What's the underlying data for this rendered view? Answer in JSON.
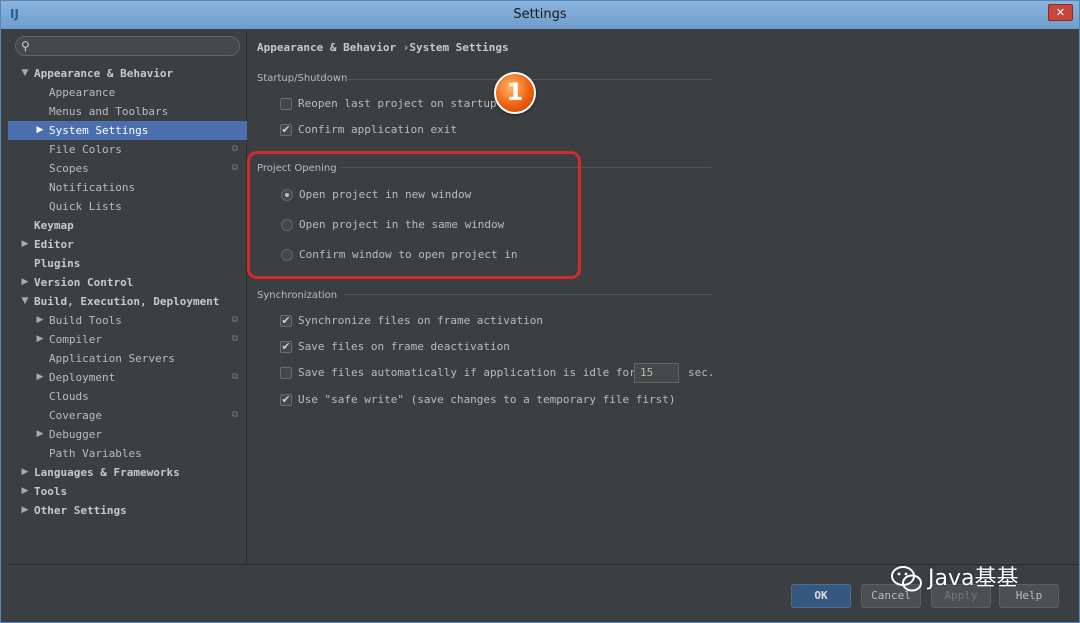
{
  "window": {
    "title": "Settings",
    "app_icon": "IJ",
    "close_label": "✕"
  },
  "search": {
    "placeholder": ""
  },
  "tree": [
    {
      "label": "Appearance & Behavior",
      "indent": 0,
      "expander": "▼",
      "bold": true
    },
    {
      "label": "Appearance",
      "indent": 1,
      "expander": "",
      "bold": false
    },
    {
      "label": "Menus and Toolbars",
      "indent": 1,
      "expander": "",
      "bold": false
    },
    {
      "label": "System Settings",
      "indent": 1,
      "expander": "▶",
      "bold": false,
      "selected": true
    },
    {
      "label": "File Colors",
      "indent": 1,
      "expander": "",
      "bold": false,
      "copy": true
    },
    {
      "label": "Scopes",
      "indent": 1,
      "expander": "",
      "bold": false,
      "copy": true
    },
    {
      "label": "Notifications",
      "indent": 1,
      "expander": "",
      "bold": false
    },
    {
      "label": "Quick Lists",
      "indent": 1,
      "expander": "",
      "bold": false
    },
    {
      "label": "Keymap",
      "indent": 0,
      "expander": "",
      "bold": true
    },
    {
      "label": "Editor",
      "indent": 0,
      "expander": "▶",
      "bold": true
    },
    {
      "label": "Plugins",
      "indent": 0,
      "expander": "",
      "bold": true
    },
    {
      "label": "Version Control",
      "indent": 0,
      "expander": "▶",
      "bold": true
    },
    {
      "label": "Build, Execution, Deployment",
      "indent": 0,
      "expander": "▼",
      "bold": true
    },
    {
      "label": "Build Tools",
      "indent": 1,
      "expander": "▶",
      "bold": false,
      "copy": true
    },
    {
      "label": "Compiler",
      "indent": 1,
      "expander": "▶",
      "bold": false,
      "copy": true
    },
    {
      "label": "Application Servers",
      "indent": 1,
      "expander": "",
      "bold": false
    },
    {
      "label": "Deployment",
      "indent": 1,
      "expander": "▶",
      "bold": false,
      "copy": true
    },
    {
      "label": "Clouds",
      "indent": 1,
      "expander": "",
      "bold": false
    },
    {
      "label": "Coverage",
      "indent": 1,
      "expander": "",
      "bold": false,
      "copy": true
    },
    {
      "label": "Debugger",
      "indent": 1,
      "expander": "▶",
      "bold": false
    },
    {
      "label": "Path Variables",
      "indent": 1,
      "expander": "",
      "bold": false
    },
    {
      "label": "Languages & Frameworks",
      "indent": 0,
      "expander": "▶",
      "bold": true
    },
    {
      "label": "Tools",
      "indent": 0,
      "expander": "▶",
      "bold": true
    },
    {
      "label": "Other Settings",
      "indent": 0,
      "expander": "▶",
      "bold": true
    }
  ],
  "breadcrumb": {
    "parent": "Appearance & Behavior",
    "separator": "›",
    "current": "System Settings"
  },
  "startup": {
    "title": "Startup/Shutdown",
    "reopen_label": "Reopen last project on startup",
    "reopen_checked": false,
    "confirm_exit_label": "Confirm application exit",
    "confirm_exit_checked": true
  },
  "project_opening": {
    "title": "Project Opening",
    "options": [
      {
        "label": "Open project in new window",
        "selected": true
      },
      {
        "label": "Open project in the same window",
        "selected": false
      },
      {
        "label": "Confirm window to open project in",
        "selected": false
      }
    ]
  },
  "sync": {
    "title": "Synchronization",
    "sync_frame_label": "Synchronize files on frame activation",
    "sync_frame_checked": true,
    "save_deactivation_label": "Save files on frame deactivation",
    "save_deactivation_checked": true,
    "save_idle_label": "Save files automatically if application is idle for",
    "save_idle_checked": false,
    "idle_value": "15",
    "idle_unit": "sec.",
    "safe_write_label": "Use \"safe write\" (save changes to a temporary file first)",
    "safe_write_checked": true
  },
  "annotation": {
    "badge": "1"
  },
  "footer": {
    "ok": "OK",
    "cancel": "Cancel",
    "apply": "Apply",
    "help": "Help"
  },
  "watermark": {
    "text": "Java基基"
  },
  "colors": {
    "selection": "#4b6eaf",
    "highlight_box": "#d42a2a",
    "badge": "#f06010"
  }
}
